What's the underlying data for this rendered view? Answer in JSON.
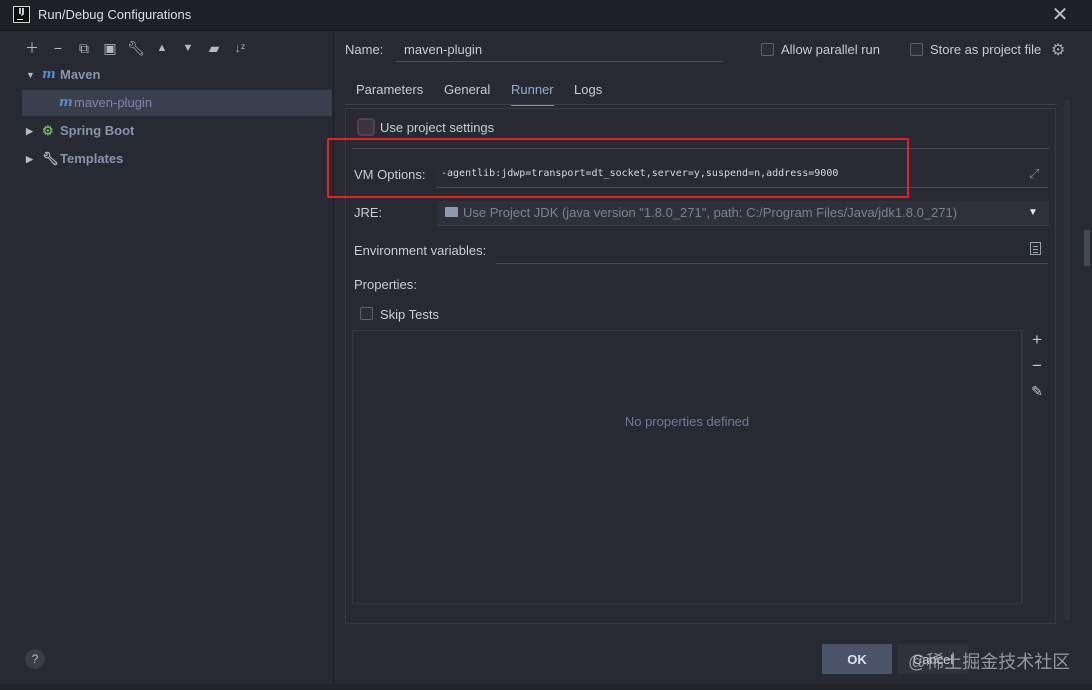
{
  "window": {
    "title": "Run/Debug Configurations",
    "app_icon": "IJ"
  },
  "toolbar": {
    "icons": [
      "add-icon",
      "remove-icon",
      "copy-icon",
      "save-icon",
      "wrench-icon",
      "move-up-icon",
      "move-down-icon",
      "folder-icon",
      "sort-icon"
    ]
  },
  "tree": {
    "maven": {
      "label": "Maven",
      "icon": "m"
    },
    "maven_plugin": {
      "label": "maven-plugin",
      "icon": "m"
    },
    "spring_boot": {
      "label": "Spring Boot"
    },
    "templates": {
      "label": "Templates"
    }
  },
  "form": {
    "name_label": "Name:",
    "name_value": "maven-plugin",
    "allow_parallel_label": "Allow parallel run",
    "store_as_file_label": "Store as project file"
  },
  "tabs": [
    "Parameters",
    "General",
    "Runner",
    "Logs"
  ],
  "runner": {
    "use_project_settings_label": "Use project settings",
    "vm_options_label": "VM Options:",
    "vm_options_value": "-agentlib:jdwp=transport=dt_socket,server=y,suspend=n,address=9000",
    "jre_label": "JRE:",
    "jre_value": "Use Project JDK (java version \"1.8.0_271\", path: C:/Program Files/Java/jdk1.8.0_271)",
    "env_label": "Environment variables:",
    "properties_label": "Properties:",
    "skip_tests_label": "Skip Tests",
    "no_properties_text": "No properties defined"
  },
  "buttons": {
    "ok": "OK",
    "cancel": "Cancel"
  },
  "watermark": "@稀土掘金技术社区",
  "colors": {
    "highlight": "#e52323",
    "accent_tab": "#8fb0d6",
    "maven_icon": "#4f8fd0"
  }
}
